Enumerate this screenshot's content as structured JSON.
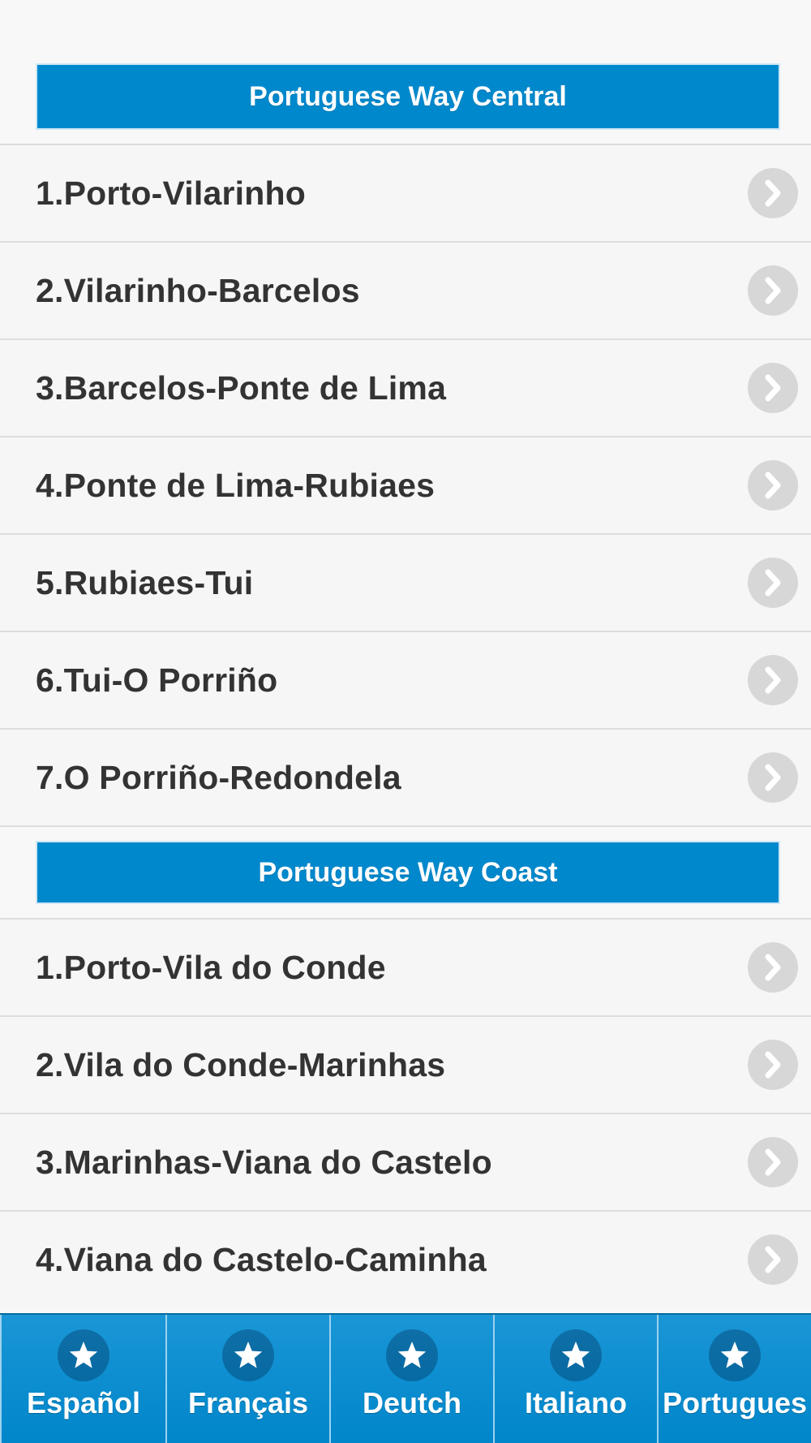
{
  "sections": [
    {
      "header": "Portuguese Way Central",
      "items": [
        {
          "label": "1.Porto-Vilarinho"
        },
        {
          "label": "2.Vilarinho-Barcelos"
        },
        {
          "label": "3.Barcelos-Ponte de Lima"
        },
        {
          "label": "4.Ponte de Lima-Rubiaes"
        },
        {
          "label": "5.Rubiaes-Tui"
        },
        {
          "label": "6.Tui-O Porriño"
        },
        {
          "label": "7.O Porriño-Redondela"
        }
      ]
    },
    {
      "header": "Portuguese Way Coast",
      "items": [
        {
          "label": "1.Porto-Vila do Conde"
        },
        {
          "label": "2.Vila do Conde-Marinhas"
        },
        {
          "label": "3.Marinhas-Viana do Castelo"
        },
        {
          "label": "4.Viana do Castelo-Caminha"
        }
      ]
    }
  ],
  "tabbar": {
    "tabs": [
      {
        "label": "Español",
        "icon": "star-icon"
      },
      {
        "label": "Français",
        "icon": "star-icon"
      },
      {
        "label": "Deutch",
        "icon": "star-icon"
      },
      {
        "label": "Italiano",
        "icon": "star-icon"
      },
      {
        "label": "Portugues",
        "icon": "star-icon"
      }
    ]
  },
  "colors": {
    "accent": "#0088cc",
    "list_text": "#333333",
    "chevron_bg": "#d7d7d7"
  }
}
